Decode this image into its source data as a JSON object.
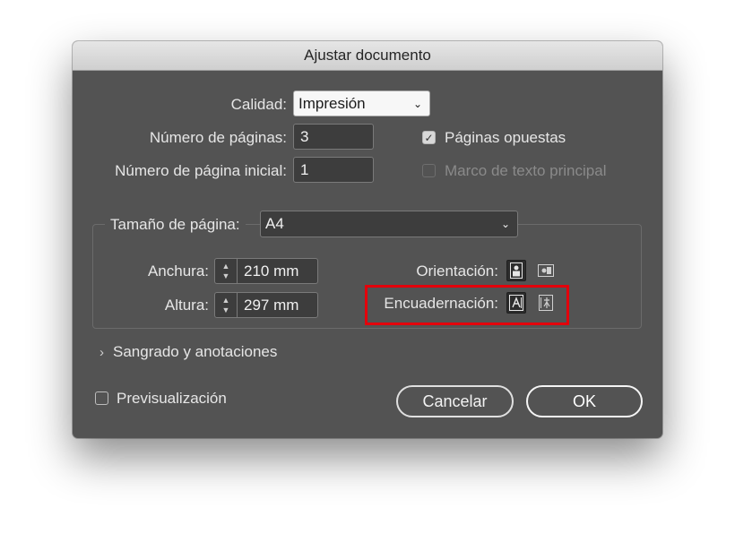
{
  "dialog": {
    "title": "Ajustar documento"
  },
  "quality": {
    "label": "Calidad:",
    "value": "Impresión"
  },
  "num_pages": {
    "label": "Número de páginas:",
    "value": "3"
  },
  "start_page": {
    "label": "Número de página inicial:",
    "value": "1"
  },
  "facing_pages": {
    "label": "Páginas opuestas",
    "checked": true
  },
  "master_text_frame": {
    "label": "Marco de texto principal",
    "checked": false,
    "disabled": true
  },
  "page_size": {
    "label": "Tamaño de página:",
    "value": "A4"
  },
  "width": {
    "label": "Anchura:",
    "value": "210 mm"
  },
  "height": {
    "label": "Altura:",
    "value": "297 mm"
  },
  "orientation": {
    "label": "Orientación:",
    "selected": "portrait"
  },
  "binding": {
    "label": "Encuadernación:",
    "selected": "left-to-right"
  },
  "bleed": {
    "label": "Sangrado y anotaciones"
  },
  "preview": {
    "label": "Previsualización",
    "checked": false
  },
  "buttons": {
    "cancel": "Cancelar",
    "ok": "OK"
  },
  "colors": {
    "dialog_bg": "#535353",
    "highlight": "#e3000b"
  }
}
